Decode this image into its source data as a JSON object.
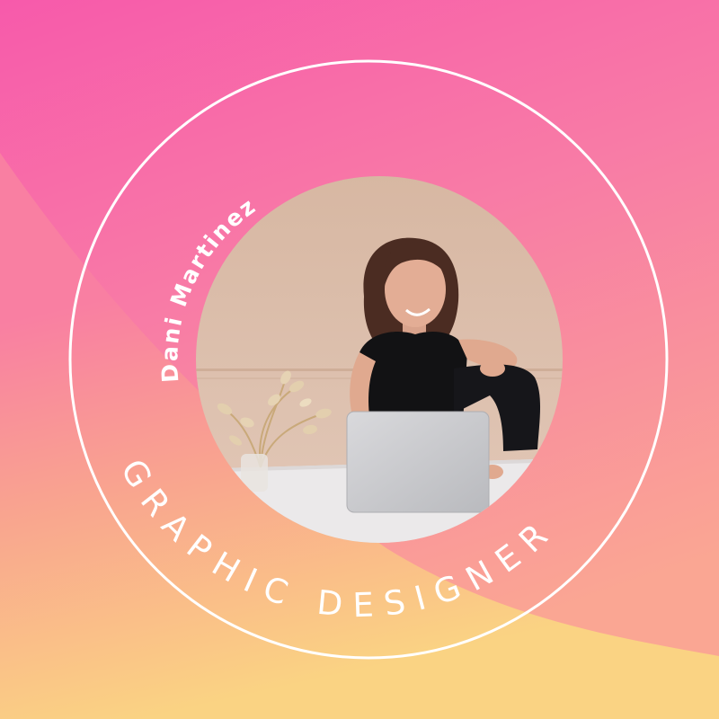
{
  "profile": {
    "name": "Dani Martinez",
    "title": "GRAPHIC DESIGNER"
  },
  "photo": {
    "subject": "woman",
    "props": [
      "laptop",
      "dried-flowers-vase",
      "desk"
    ]
  },
  "colors": {
    "background_top": "#f85aa9",
    "background_mid": "#f98aa4",
    "background_bottom": "#fad184",
    "ring": "#ffffff",
    "text": "#ffffff",
    "wall": "#dbbba6"
  }
}
